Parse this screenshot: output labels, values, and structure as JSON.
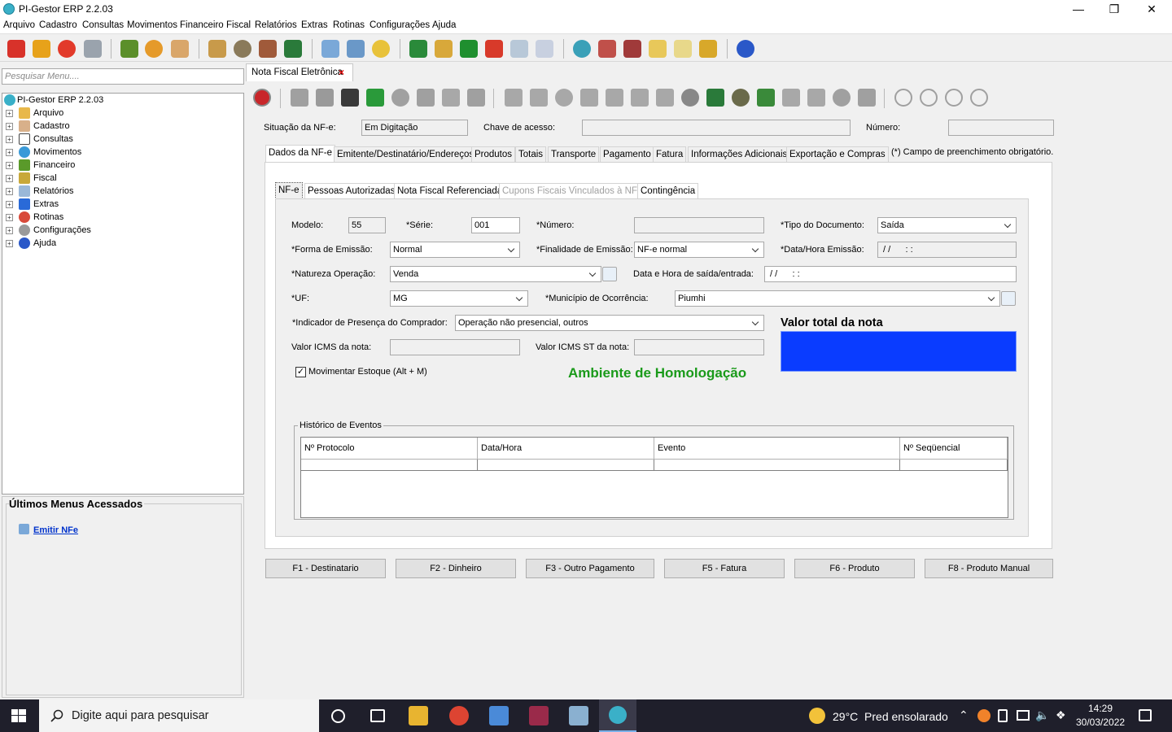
{
  "window": {
    "title": "PI-Gestor ERP 2.2.03",
    "minimize": "—",
    "maximize": "❐",
    "close": "✕"
  },
  "menu": [
    "Arquivo",
    "Cadastro",
    "Consultas",
    "Movimentos",
    "Financeiro",
    "Fiscal",
    "Relatórios",
    "Extras",
    "Rotinas",
    "Configurações",
    "Ajuda"
  ],
  "sidebar": {
    "search_placeholder": "Pesquisar Menu....",
    "root": "PI-Gestor ERP 2.2.03",
    "items": [
      "Arquivo",
      "Cadastro",
      "Consultas",
      "Movimentos",
      "Financeiro",
      "Fiscal",
      "Relatórios",
      "Extras",
      "Rotinas",
      "Configurações",
      "Ajuda"
    ],
    "recent_title": "Últimos Menus Acessados",
    "recent_items": [
      "Emitir NFe"
    ]
  },
  "doc_tab": {
    "label": "Nota Fiscal Eletrônica",
    "close": "×"
  },
  "header_fields": {
    "situacao_label": "Situação da NF-e:",
    "situacao_value": "Em Digitação",
    "chave_label": "Chave de acesso:",
    "chave_value": "",
    "numero_label": "Número:",
    "numero_value": ""
  },
  "main_tabs": [
    "Dados da NF-e",
    "Emitente/Destinatário/Endereços",
    "Produtos",
    "Totais",
    "Transporte",
    "Pagamento",
    "Fatura",
    "Informações Adicionais",
    "Exportação e Compras"
  ],
  "required_note": "(*) Campo de preenchimento obrigatório.",
  "sub_tabs": [
    "NF-e",
    "Pessoas Autorizadas",
    "Nota Fiscal Referenciada",
    "Cupons Fiscais Vinculados à NF-e",
    "Contingência"
  ],
  "form": {
    "modelo_label": "Modelo:",
    "modelo_value": "55",
    "serie_label": "*Série:",
    "serie_value": "001",
    "numero_label": "*Número:",
    "numero_value": "",
    "tipo_label": "*Tipo do Documento:",
    "tipo_value": "Saída",
    "forma_label": "*Forma de Emissão:",
    "forma_value": "Normal",
    "finalidade_label": "*Finalidade de Emissão:",
    "finalidade_value": "NF-e normal",
    "data_emissao_label": "*Data/Hora Emissão:",
    "data_emissao_value": " / /      : :",
    "natureza_label": "*Natureza Operação:",
    "natureza_value": "Venda",
    "data_saida_label": "Data e Hora de saída/entrada:",
    "data_saida_value": " / /      : :",
    "uf_label": "*UF:",
    "uf_value": "MG",
    "municipio_label": "*Município de Ocorrência:",
    "municipio_value": "Piumhi",
    "presenca_label": "*Indicador de Presença do Comprador:",
    "presenca_value": "Operação não presencial, outros",
    "icms_label": "Valor ICMS da nota:",
    "icms_value": "",
    "icms_st_label": "Valor ICMS ST da nota:",
    "icms_st_value": "",
    "estoque_label": "Movimentar Estoque (Alt + M)",
    "estoque_checked": true,
    "valor_total_label": "Valor total da nota",
    "valor_total_color": "#0a3cff",
    "ambiente": "Ambiente de Homologação",
    "ambiente_color": "#1a9a1a"
  },
  "history": {
    "title": "Histórico de Eventos",
    "columns": [
      "Nº Protocolo",
      "Data/Hora",
      "Evento",
      "Nº Seqüencial"
    ],
    "rows": []
  },
  "function_buttons": [
    "F1 - Destinatario",
    "F2 - Dinheiro",
    "F3 - Outro Pagamento",
    "F5 - Fatura",
    "F6 - Produto",
    "F8 - Produto Manual"
  ],
  "taskbar": {
    "search_placeholder": "Digite aqui para pesquisar",
    "weather": "29°C  Pred ensolarado",
    "time": "14:29",
    "date": "30/03/2022"
  }
}
